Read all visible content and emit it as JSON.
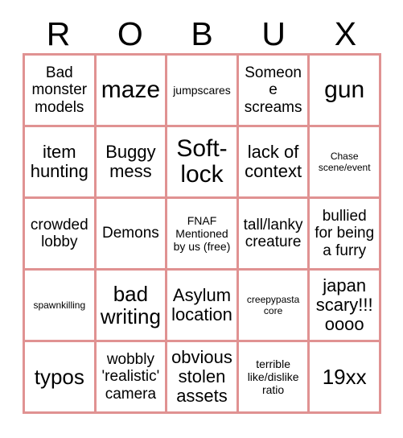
{
  "card": {
    "title_letters": [
      "R",
      "O",
      "B",
      "U",
      "X"
    ],
    "border_color": "#e09292",
    "background_color": "#ffffff",
    "text_color": "#000000",
    "grid_size": "5x5"
  },
  "cells": [
    {
      "text": "Bad monster models",
      "size": "md"
    },
    {
      "text": "maze",
      "size": "xxl"
    },
    {
      "text": "jumpscares",
      "size": "sm"
    },
    {
      "text": "Someone screams",
      "size": "md"
    },
    {
      "text": "gun",
      "size": "xxl"
    },
    {
      "text": "item hunting",
      "size": "lg"
    },
    {
      "text": "Buggy mess",
      "size": "lg"
    },
    {
      "text": "Soft-lock",
      "size": "xxl"
    },
    {
      "text": "lack of context",
      "size": "lg"
    },
    {
      "text": "Chase scene/event",
      "size": "xs"
    },
    {
      "text": "crowded lobby",
      "size": "md"
    },
    {
      "text": "Demons",
      "size": "md"
    },
    {
      "text": "FNAF Mentioned by us (free)",
      "size": "sm"
    },
    {
      "text": "tall/lanky creature",
      "size": "md"
    },
    {
      "text": "bullied for being a furry",
      "size": "md"
    },
    {
      "text": "spawnkilling",
      "size": "xs"
    },
    {
      "text": "bad writing",
      "size": "xl"
    },
    {
      "text": "Asylum location",
      "size": "lg"
    },
    {
      "text": "creepypasta core",
      "size": "xs"
    },
    {
      "text": "japan scary!!! oooo",
      "size": "lg"
    },
    {
      "text": "typos",
      "size": "xl"
    },
    {
      "text": "wobbly 'realistic' camera",
      "size": "md"
    },
    {
      "text": "obvious stolen assets",
      "size": "lg"
    },
    {
      "text": "terrible like/dislike ratio",
      "size": "sm"
    },
    {
      "text": "19xx",
      "size": "xl"
    }
  ]
}
